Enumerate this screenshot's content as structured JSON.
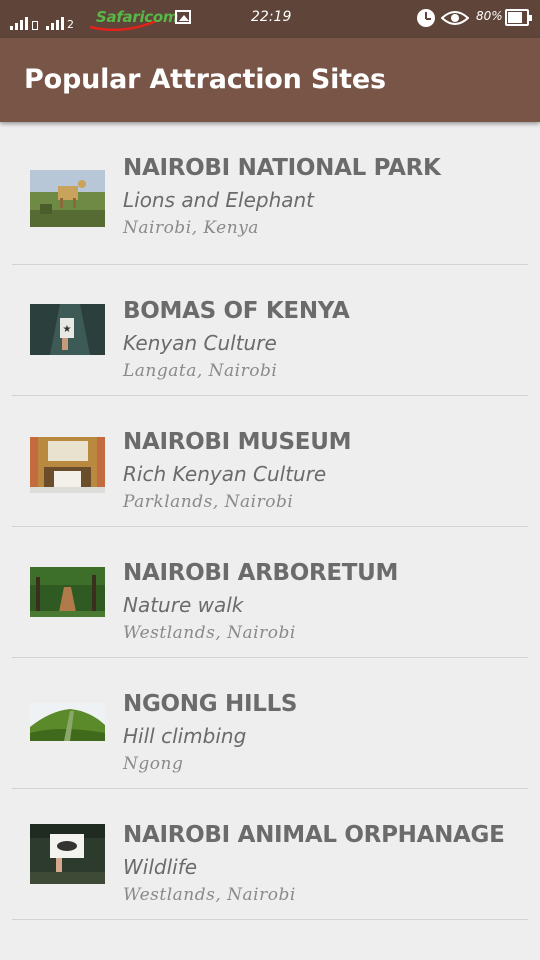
{
  "status_bar": {
    "sim_label": "2",
    "carrier": "Safaricom",
    "time": "22:19",
    "battery": "80%",
    "battery_level": 0.8,
    "icons": [
      "signal-icon",
      "gallery-icon",
      "alarm-icon",
      "eye-icon",
      "battery-icon"
    ]
  },
  "app_bar": {
    "title": "Popular Attraction Sites"
  },
  "attractions": [
    {
      "name": "NAIROBI NATIONAL PARK",
      "description": "Lions and Elephant",
      "location": "Nairobi, Kenya"
    },
    {
      "name": "BOMAS OF KENYA",
      "description": "Kenyan Culture",
      "location": "Langata, Nairobi"
    },
    {
      "name": "NAIROBI MUSEUM",
      "description": "Rich Kenyan Culture",
      "location": "Parklands, Nairobi"
    },
    {
      "name": "NAIROBI ARBORETUM",
      "description": "Nature walk",
      "location": "Westlands, Nairobi"
    },
    {
      "name": "NGONG HILLS",
      "description": "Hill climbing",
      "location": "Ngong"
    },
    {
      "name": "NAIROBI ANIMAL ORPHANAGE",
      "description": "Wildlife",
      "location": "Westlands, Nairobi"
    }
  ],
  "colors": {
    "status_bar": "#5f4439",
    "app_bar": "#795548",
    "background": "#eeeeee",
    "primary_text": "#6b6b6b"
  }
}
